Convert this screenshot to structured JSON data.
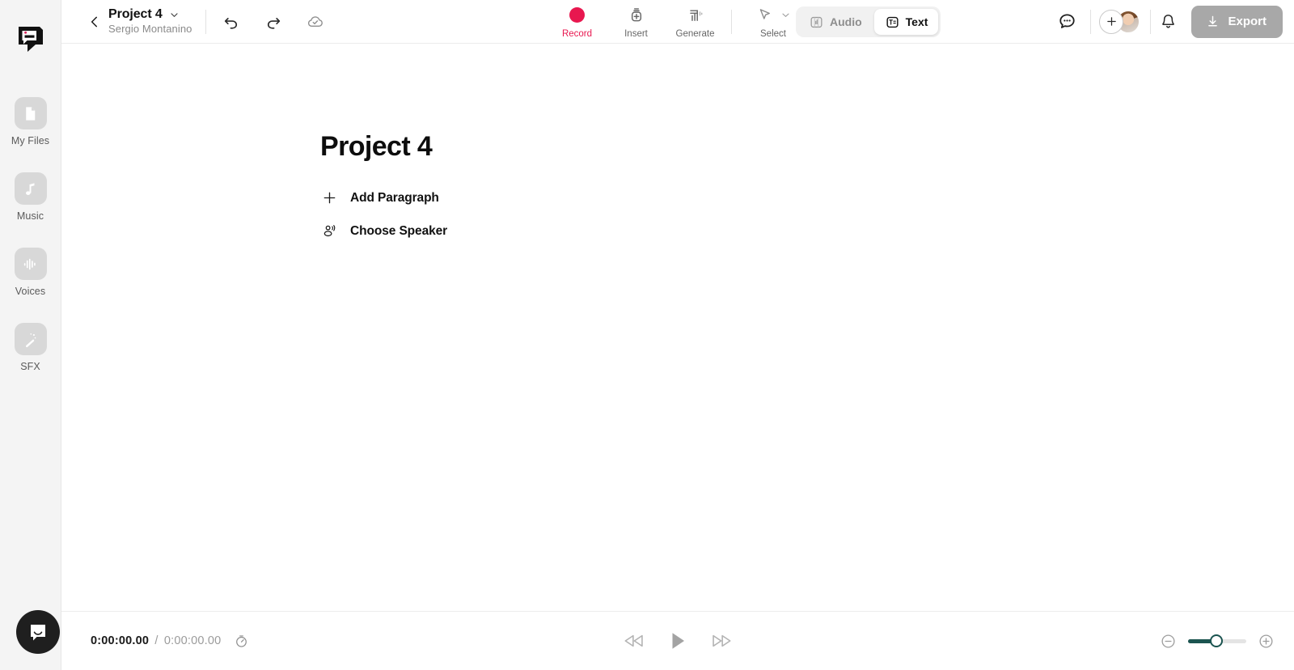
{
  "app": {
    "logo_icon": "descript-logo-icon",
    "accent_record": "#e8174f",
    "accent_slider": "#1b5450"
  },
  "sidebar": {
    "items": [
      {
        "label": "My Files",
        "icon": "file-icon"
      },
      {
        "label": "Music",
        "icon": "music-note-icon"
      },
      {
        "label": "Voices",
        "icon": "waveform-icon"
      },
      {
        "label": "SFX",
        "icon": "magic-wand-icon"
      }
    ],
    "help_widget": {
      "name": "intercom-chat-bubble",
      "icon": "chat-smile-icon"
    }
  },
  "topbar": {
    "back_icon": "chevron-left-icon",
    "project_title": "Project 4",
    "project_dropdown_icon": "chevron-down-icon",
    "project_owner": "Sergio Montanino",
    "history": [
      {
        "name": "undo",
        "icon": "undo-arrow-icon"
      },
      {
        "name": "redo",
        "icon": "redo-arrow-icon"
      },
      {
        "name": "save-status",
        "icon": "cloud-check-icon"
      }
    ],
    "tools": [
      {
        "label": "Record",
        "icon": "record-dot-icon"
      },
      {
        "label": "Insert",
        "icon": "insert-plus-icon"
      },
      {
        "label": "Generate",
        "icon": "generate-bars-icon"
      },
      {
        "label": "Select",
        "icon": "cursor-arrow-icon",
        "has_dropdown": true
      }
    ],
    "mode_toggle": {
      "options": [
        {
          "label": "Audio",
          "icon": "audio-track-icon",
          "active": false
        },
        {
          "label": "Text",
          "icon": "text-box-icon",
          "active": true
        }
      ]
    },
    "comments_icon": "comment-bubble-icon",
    "add_people_icon": "plus-icon",
    "avatar": "user-avatar",
    "notifications_icon": "bell-icon",
    "export_label": "Export",
    "export_icon": "download-arrow-icon"
  },
  "document": {
    "title": "Project 4",
    "actions": [
      {
        "label": "Add Paragraph",
        "icon": "plus-icon"
      },
      {
        "label": "Choose Speaker",
        "icon": "speaker-person-icon"
      }
    ]
  },
  "bottombar": {
    "current_time": "0:00:00.00",
    "separator": "/",
    "total_time": "0:00:00.00",
    "timer_icon": "stopwatch-icon",
    "transport": [
      {
        "name": "rewind",
        "icon": "rewind-icon"
      },
      {
        "name": "play",
        "icon": "play-icon"
      },
      {
        "name": "fast-forward",
        "icon": "fast-forward-icon"
      }
    ],
    "zoom": {
      "out_icon": "minus-circle-icon",
      "in_icon": "plus-circle-icon",
      "value_percent": 48
    }
  }
}
